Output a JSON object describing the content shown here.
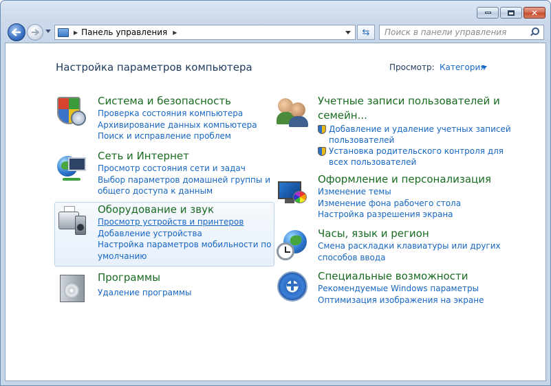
{
  "window": {
    "caption_buttons": {
      "minimize": "minimize",
      "maximize": "maximize",
      "close": "✕"
    }
  },
  "nav": {
    "address": "Панель управления",
    "search_placeholder": "Поиск в панели управления"
  },
  "header": {
    "title": "Настройка параметров компьютера",
    "view_by_label": "Просмотр:",
    "view_by_value": "Категория"
  },
  "categories": {
    "security": {
      "title": "Система и безопасность",
      "links": [
        "Проверка состояния компьютера",
        "Архивирование данных компьютера",
        "Поиск и исправление проблем"
      ]
    },
    "network": {
      "title": "Сеть и Интернет",
      "links": [
        "Просмотр состояния сети и задач",
        "Выбор параметров домашней группы и",
        "общего доступа к данным"
      ]
    },
    "hardware": {
      "title": "Оборудование и звук",
      "links": [
        "Просмотр устройств и принтеров",
        "Добавление устройства",
        "Настройка параметров мобильности по",
        "умолчанию"
      ]
    },
    "programs": {
      "title": "Программы",
      "links": [
        "Удаление программы"
      ]
    },
    "users": {
      "title_line1": "Учетные записи пользователей и",
      "title_line2": "семейн...",
      "links": [
        "Добавление и удаление учетных записей",
        "пользователей",
        "Установка родительского контроля для",
        "всех пользователей"
      ]
    },
    "appearance": {
      "title": "Оформление и персонализация",
      "links": [
        "Изменение темы",
        "Изменение фона рабочего стола",
        "Настройка разрешения экрана"
      ]
    },
    "clock": {
      "title": "Часы, язык и регион",
      "links": [
        "Смена раскладки клавиатуры или других",
        "способов ввода"
      ]
    },
    "access": {
      "title": "Специальные возможности",
      "links": [
        "Рекомендуемые Windows параметры",
        "Оптимизация изображения на экране"
      ]
    }
  },
  "colors": {
    "category_title": "#196b21",
    "link": "#1666c4",
    "heading": "#1e395b"
  }
}
